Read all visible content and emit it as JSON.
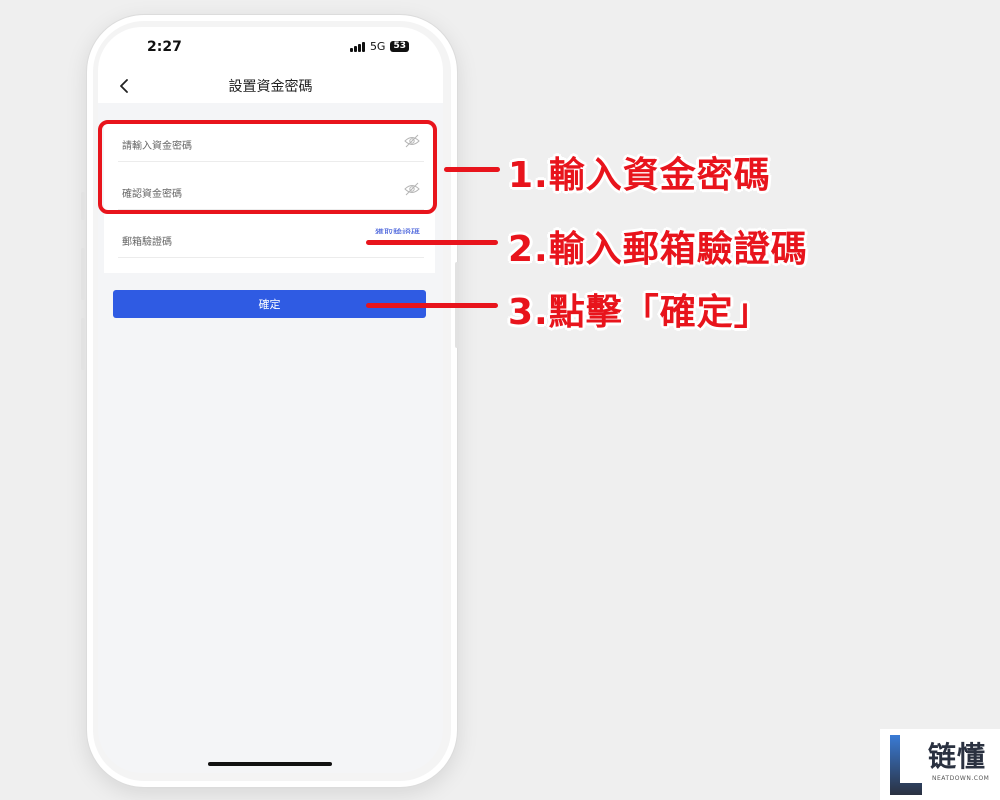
{
  "status_bar": {
    "time": "2:27",
    "network": "5G",
    "battery": "53"
  },
  "nav": {
    "title": "設置資金密碼"
  },
  "form": {
    "fund_password_placeholder": "請輸入資金密碼",
    "confirm_password_placeholder": "確認資金密碼",
    "email_code_placeholder": "郵箱驗證碼",
    "get_code_label": "獲取驗證碼"
  },
  "confirm_button_label": "確定",
  "annotations": {
    "step1": "1.輸入資金密碼",
    "step2": "2.輸入郵箱驗證碼",
    "step3": "3.點擊「確定」",
    "color": "#e8141c"
  },
  "watermark": {
    "name_cn": "链懂",
    "name_en": "NEATDOWN.COM"
  },
  "colors": {
    "primary_button": "#2f5be3",
    "page_bg": "#efefef"
  }
}
